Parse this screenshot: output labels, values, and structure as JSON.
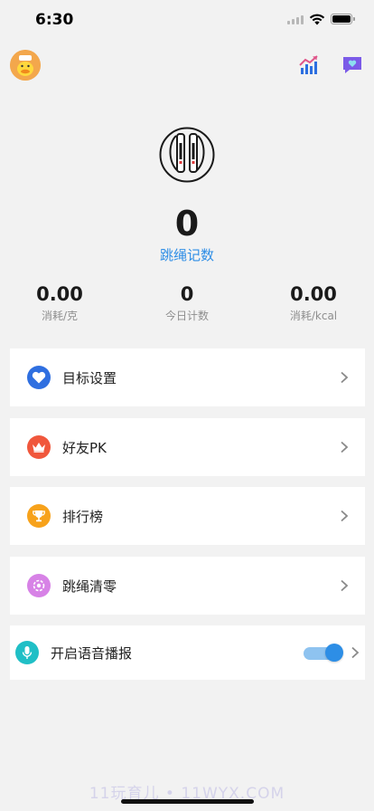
{
  "status_bar": {
    "time": "6:30"
  },
  "counter": {
    "value": "0",
    "label": "跳绳记数"
  },
  "stats": [
    {
      "value": "0.00",
      "label": "消耗/克"
    },
    {
      "value": "0",
      "label": "今日计数"
    },
    {
      "value": "0.00",
      "label": "消耗/kcal"
    }
  ],
  "menu": [
    {
      "label": "目标设置",
      "icon": "heart-icon",
      "color": "#2f6fe0"
    },
    {
      "label": "好友PK",
      "icon": "crown-icon",
      "color": "#f0573c"
    },
    {
      "label": "排行榜",
      "icon": "trophy-icon",
      "color": "#f7a21b"
    },
    {
      "label": "跳绳清零",
      "icon": "reset-icon",
      "color": "#d782e6"
    }
  ],
  "voice": {
    "label": "开启语音播报",
    "enabled": true,
    "icon": "microphone-icon",
    "color": "#20bfc6"
  },
  "watermark": "11玩育儿 • 11WYX.COM"
}
